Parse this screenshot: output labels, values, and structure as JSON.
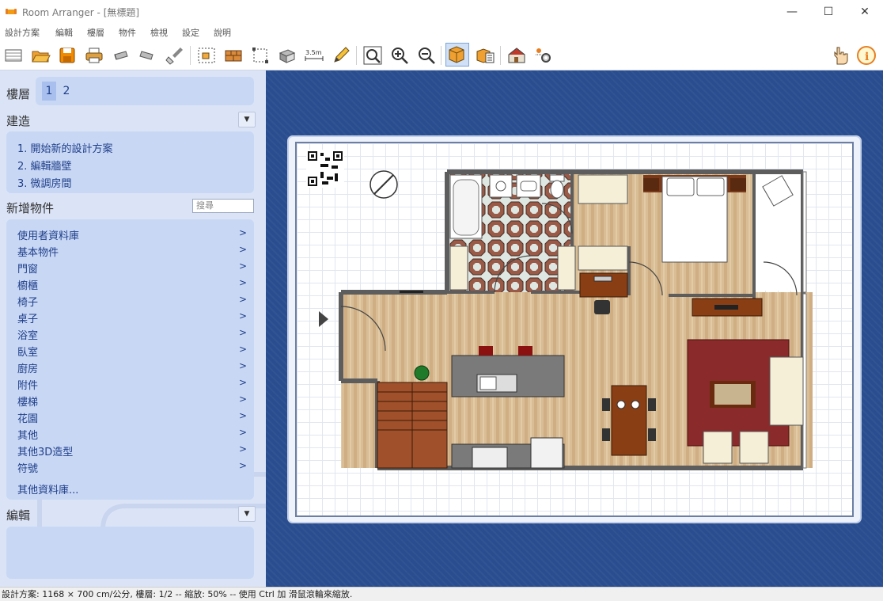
{
  "window": {
    "title": "Room Arranger - [無標題]",
    "minimize": "—",
    "maximize": "☐",
    "close": "✕"
  },
  "menu": [
    "設計方案",
    "編輯",
    "樓層",
    "物件",
    "檢視",
    "設定",
    "說明"
  ],
  "toolbar": {
    "icons": [
      "new-project-icon",
      "open-folder-icon",
      "save-icon",
      "print-icon",
      "undo-icon",
      "redo-icon",
      "clear-icon",
      "room-edit-icon",
      "wall-icon",
      "select-area-icon",
      "object-move-icon",
      "measure-icon",
      "pencil-icon",
      "zoom-fit-icon",
      "zoom-in-icon",
      "zoom-out-icon",
      "2d-view-icon",
      "3d-view-icon",
      "house-3d-icon",
      "settings-gear-icon",
      "hand-icon",
      "info-icon"
    ],
    "measure_label": "3.5m",
    "accent": "#e67e22"
  },
  "sidebar": {
    "floors": {
      "label": "樓層",
      "items": [
        "1",
        "2"
      ],
      "active": "1"
    },
    "build": {
      "title": "建造",
      "links": [
        "1. 開始新的設計方案",
        "2. 編輯牆壁",
        "3. 微調房間"
      ]
    },
    "add_objects": {
      "title": "新增物件",
      "search_placeholder": "搜尋",
      "categories": [
        "使用者資料庫",
        "基本物件",
        "門窗",
        "櫥櫃",
        "椅子",
        "桌子",
        "浴室",
        "臥室",
        "廚房",
        "附件",
        "樓梯",
        "花園",
        "其他",
        "其他3D造型",
        "符號"
      ],
      "more": "其他資料庫..."
    },
    "edit": {
      "title": "編輯"
    }
  },
  "canvas": {
    "background": "#294d8f"
  },
  "status": {
    "text": "設計方案: 1168 × 700 cm/公分, 樓層: 1/2 -- 縮放: 50% -- 使用 Ctrl 加 滑鼠滾輪來縮放."
  }
}
